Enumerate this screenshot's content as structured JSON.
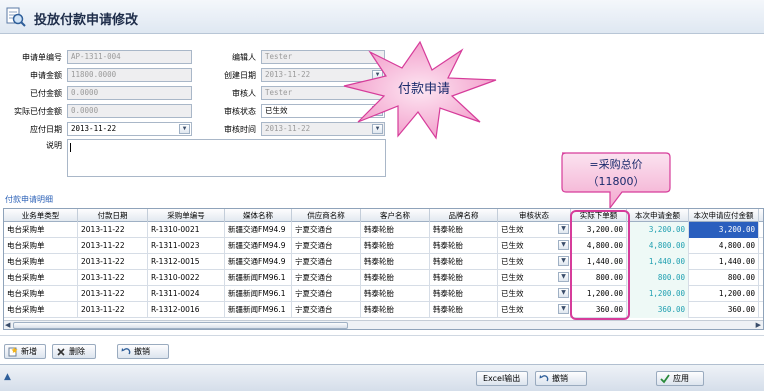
{
  "title": "投放付款申请修改",
  "form": {
    "application_no_label": "申请单编号",
    "application_no_value": "AP-1311-004",
    "apply_amount_label": "申请金额",
    "apply_amount_value": "11800.0000",
    "paid_amount_label": "已付金额",
    "paid_amount_value": "0.0000",
    "actual_paid_label": "实际已付金额",
    "actual_paid_value": "0.0000",
    "pay_date_label": "应付日期",
    "pay_date_value": "2013-11-22",
    "remark_label": "说明",
    "editor_label": "编辑人",
    "editor_value": "Tester",
    "create_date_label": "创建日期",
    "create_date_value": "2013-11-22",
    "auditor_label": "审核人",
    "auditor_value": "Tester",
    "audit_status_label": "审核状态",
    "audit_status_value": "已生效",
    "audit_time_label": "审核时间",
    "audit_time_value": "2013-11-22"
  },
  "callout_star": {
    "text": "付款申请"
  },
  "callout_box": {
    "line1": "=采购总价",
    "line2": "（11800）"
  },
  "detail_label": "付款申请明细",
  "grid": {
    "headers": [
      "业务单类型",
      "付款日期",
      "采购单编号",
      "媒体名称",
      "供应商名称",
      "客户名称",
      "品牌名称",
      "审核状态",
      "实际下单额",
      "本次申请金额",
      "本次申请应付金额"
    ],
    "rows": [
      [
        "电台采购单",
        "2013-11-22",
        "R-1310-0021",
        "新疆交通FM94.9",
        "宁夏交通台",
        "韩泰轮胎",
        "韩泰轮胎",
        "已生效",
        "3,200.00",
        "3,200.00",
        "3,200.00"
      ],
      [
        "电台采购单",
        "2013-11-22",
        "R-1311-0023",
        "新疆交通FM94.9",
        "宁夏交通台",
        "韩泰轮胎",
        "韩泰轮胎",
        "已生效",
        "4,800.00",
        "4,800.00",
        "4,800.00"
      ],
      [
        "电台采购单",
        "2013-11-22",
        "R-1312-0015",
        "新疆交通FM94.9",
        "宁夏交通台",
        "韩泰轮胎",
        "韩泰轮胎",
        "已生效",
        "1,440.00",
        "1,440.00",
        "1,440.00"
      ],
      [
        "电台采购单",
        "2013-11-22",
        "R-1310-0022",
        "新疆新闻FM96.1",
        "宁夏交通台",
        "韩泰轮胎",
        "韩泰轮胎",
        "已生效",
        "800.00",
        "800.00",
        "800.00"
      ],
      [
        "电台采购单",
        "2013-11-22",
        "R-1311-0024",
        "新疆新闻FM96.1",
        "宁夏交通台",
        "韩泰轮胎",
        "韩泰轮胎",
        "已生效",
        "1,200.00",
        "1,200.00",
        "1,200.00"
      ],
      [
        "电台采购单",
        "2013-11-22",
        "R-1312-0016",
        "新疆新闻FM96.1",
        "宁夏交通台",
        "韩泰轮胎",
        "韩泰轮胎",
        "已生效",
        "360.00",
        "360.00",
        "360.00"
      ]
    ]
  },
  "toolbar": {
    "add": "新增",
    "delete": "删除",
    "undo": "撤销"
  },
  "bottom": {
    "excel": "Excel输出",
    "undo": "撤销",
    "apply": "应用"
  },
  "colors": {
    "highlight": "#d63c9a",
    "accent_blue": "#2a5fbe",
    "amount_cyan": "#1f9fb0"
  }
}
